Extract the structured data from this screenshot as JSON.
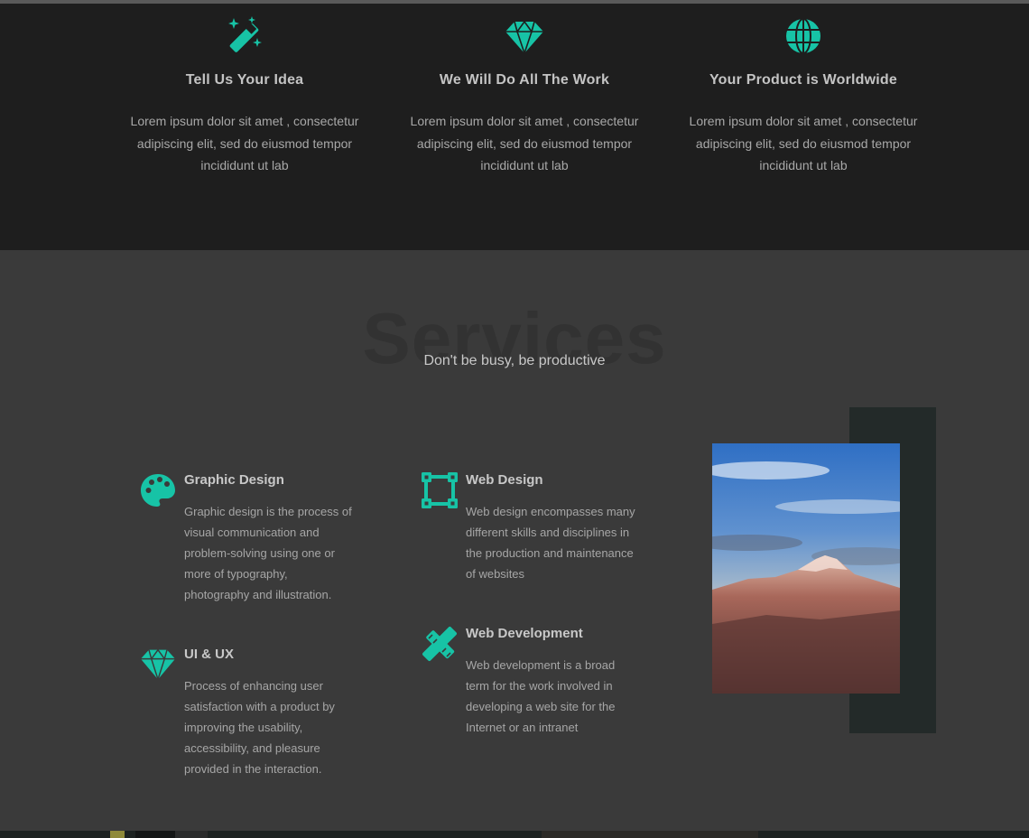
{
  "colors": {
    "accent": "#17c3a6",
    "dark_band": "#1e1e1e",
    "section_bg": "#3a3a3a"
  },
  "features": [
    {
      "icon": "magic-wand-icon",
      "title": "Tell Us Your Idea",
      "text": "Lorem ipsum dolor sit amet , consectetur adipiscing elit, sed do eiusmod tempor incididunt ut lab"
    },
    {
      "icon": "diamond-icon",
      "title": "We Will Do All The Work",
      "text": "Lorem ipsum dolor sit amet , consectetur adipiscing elit, sed do eiusmod tempor incididunt ut lab"
    },
    {
      "icon": "globe-icon",
      "title": "Your Product is Worldwide",
      "text": "Lorem ipsum dolor sit amet , consectetur adipiscing elit, sed do eiusmod tempor incididunt ut lab"
    }
  ],
  "services": {
    "title": "Services",
    "tagline": "Don't be busy, be productive",
    "items": [
      {
        "icon": "palette-icon",
        "title": "Graphic Design",
        "text": "Graphic design is the process of visual communication and problem-solving using one or more of typography, photography and illustration."
      },
      {
        "icon": "vector-square-icon",
        "title": "Web Design",
        "text": "Web design encompasses many different skills and disciplines in the production and maintenance of websites"
      },
      {
        "icon": "diamond-icon",
        "title": "UI & UX",
        "text": "Process of enhancing user satisfaction with a product by improving the usability, accessibility, and pleasure provided in the interaction."
      },
      {
        "icon": "pencil-ruler-icon",
        "title": "Web Development",
        "text": "Web development is a broad term for the work involved in developing a web site for the Internet or an intranet"
      }
    ]
  }
}
